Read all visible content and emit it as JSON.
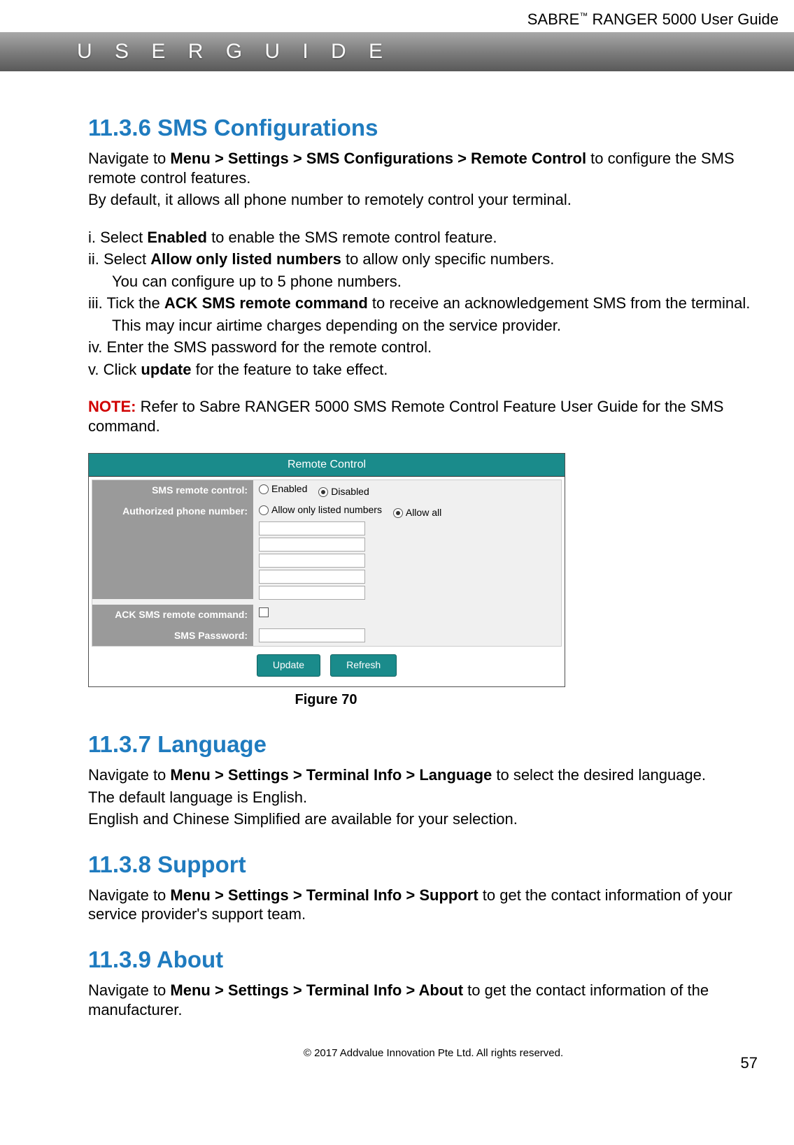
{
  "header": {
    "product": "SABRE",
    "tm": "™",
    "model": "RANGER 5000 User Guide"
  },
  "banner": {
    "text": "U S E R   G U I D E"
  },
  "s1": {
    "heading": "11.3.6 SMS Configurations",
    "p1a": "Navigate to ",
    "p1b": "Menu > Settings > SMS Configurations > Remote Control",
    "p1c": " to configure the SMS remote control features.",
    "p2": "By default, it allows all phone number to remotely control your terminal.",
    "i1a": "i.  Select ",
    "i1b": "Enabled",
    "i1c": " to enable the SMS remote control feature.",
    "i2a": "ii. Select ",
    "i2b": "Allow only listed numbers",
    "i2c": " to allow only specific numbers.",
    "i2d": "You can configure up to 5 phone numbers.",
    "i3a": "iii. Tick the ",
    "i3b": "ACK SMS remote command",
    "i3c": " to receive an acknowledgement SMS from the terminal. This may incur airtime charges depending on the service provider.",
    "i3d": "This may incur airtime charges depending on the service provider.",
    "i4": "iv. Enter the SMS password for the remote control.",
    "i5a": "v.  Click ",
    "i5b": "update",
    "i5c": " for the feature to take effect.",
    "note_label": "NOTE:",
    "note_text": " Refer to Sabre RANGER 5000 SMS Remote Control Feature User Guide for the SMS command."
  },
  "figure": {
    "title": "Remote Control",
    "rows": {
      "sms_remote": "SMS remote control:",
      "auth_phone": "Authorized phone number:",
      "ack": "ACK SMS remote command:",
      "pwd": "SMS Password:"
    },
    "opts": {
      "enabled": "Enabled",
      "disabled": "Disabled",
      "allow_listed": "Allow only listed numbers",
      "allow_all": "Allow all"
    },
    "buttons": {
      "update": "Update",
      "refresh": "Refresh"
    },
    "caption": "Figure 70"
  },
  "s2": {
    "heading": "11.3.7 Language",
    "p1a": "Navigate to ",
    "p1b": "Menu > Settings > Terminal Info > Language",
    "p1c": " to select the desired language.",
    "p2": "The default language is English.",
    "p3": "English and Chinese Simplified are available for your selection."
  },
  "s3": {
    "heading": "11.3.8 Support",
    "p1a": "Navigate to ",
    "p1b": "Menu > Settings > Terminal Info > Support",
    "p1c": " to get the contact information of your service provider's support team."
  },
  "s4": {
    "heading": "11.3.9 About",
    "p1a": "Navigate to ",
    "p1b": "Menu > Settings > Terminal Info > About",
    "p1c": " to get the contact information of the manufacturer."
  },
  "footer": {
    "copyright": "© 2017 Addvalue Innovation Pte Ltd. All rights reserved.",
    "page": "57"
  }
}
